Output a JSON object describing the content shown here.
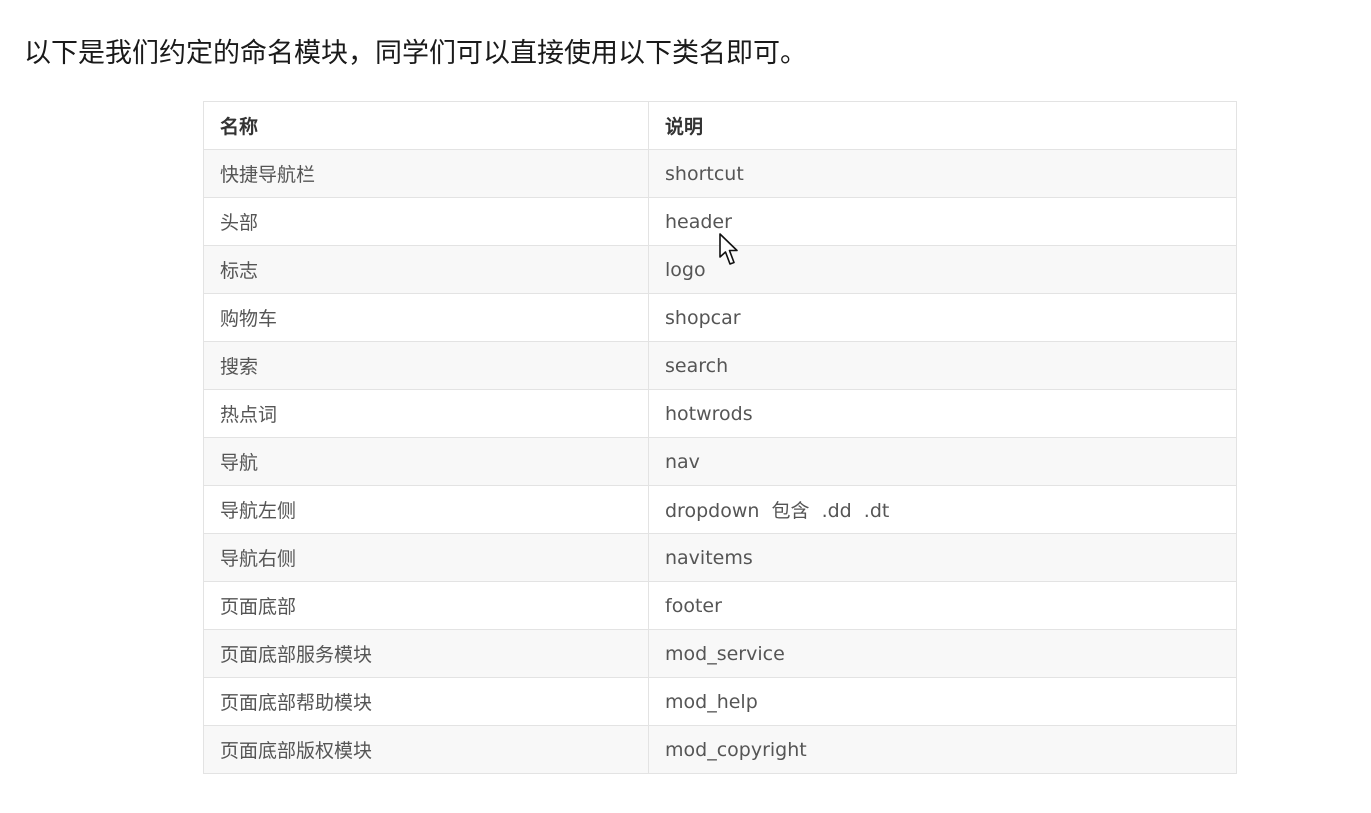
{
  "intro_text": "以下是我们约定的命名模块，同学们可以直接使用以下类名即可。",
  "table": {
    "headers": [
      "名称",
      "说明"
    ],
    "rows": [
      [
        "快捷导航栏",
        "shortcut"
      ],
      [
        "头部",
        "header"
      ],
      [
        "标志",
        "logo"
      ],
      [
        "购物车",
        "shopcar"
      ],
      [
        "搜索",
        "search"
      ],
      [
        "热点词",
        "hotwrods"
      ],
      [
        "导航",
        "nav"
      ],
      [
        "导航左侧",
        "dropdown  包含  .dd  .dt"
      ],
      [
        "导航右侧",
        "navitems"
      ],
      [
        "页面底部",
        "footer"
      ],
      [
        "页面底部服务模块",
        "mod_service"
      ],
      [
        "页面底部帮助模块",
        "mod_help"
      ],
      [
        "页面底部版权模块",
        "mod_copyright"
      ]
    ]
  },
  "cursor_icon": "arrow-pointer-icon"
}
